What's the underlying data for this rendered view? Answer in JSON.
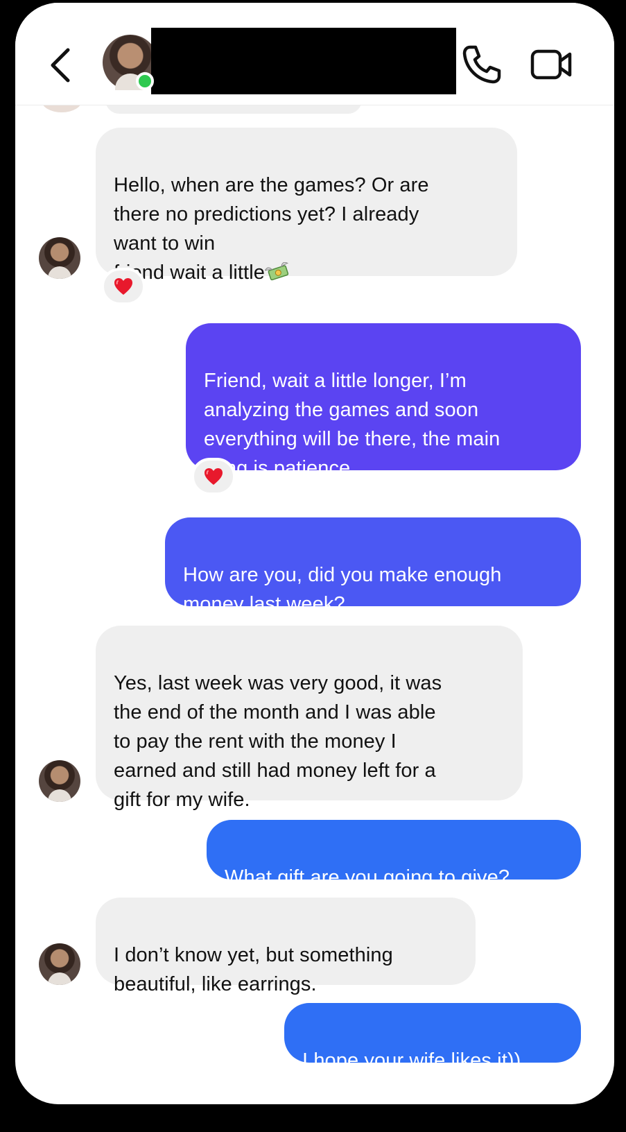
{
  "header": {
    "back_label": "Back",
    "call_icon": "phone-icon",
    "video_icon": "video-camera-icon",
    "contact_status": "online"
  },
  "colors": {
    "incoming_bubble": "#efefef",
    "outgoing_purple": "#5b44f2",
    "outgoing_mid": "#4b58f3",
    "outgoing_blue": "#2f6ff5",
    "online_dot": "#2ec94f",
    "heart": "#e8192c"
  },
  "messages": [
    {
      "direction": "incoming",
      "text": "Hello, when are the games? Or are\nthere no predictions yet? I already\nwant to win\nfriend wait a little",
      "emoji": "money-with-wings",
      "reaction": "❤️"
    },
    {
      "direction": "outgoing",
      "text": "Friend, wait a little longer, I’m\nanalyzing the games and soon\neverything will be there, the main\nthing is patience.",
      "reaction": "❤️"
    },
    {
      "direction": "outgoing",
      "text": "How are you, did you make enough\nmoney last week?"
    },
    {
      "direction": "incoming",
      "text": "Yes, last week was very good, it was\nthe end of the month and I was able\nto pay the rent with the money I\nearned and still had money left for a\ngift for my wife."
    },
    {
      "direction": "outgoing",
      "text": "What gift are you going to give?"
    },
    {
      "direction": "incoming",
      "text": "I don’t know yet, but something\nbeautiful, like earrings."
    },
    {
      "direction": "outgoing",
      "text": "I hope your wife likes it))"
    }
  ]
}
